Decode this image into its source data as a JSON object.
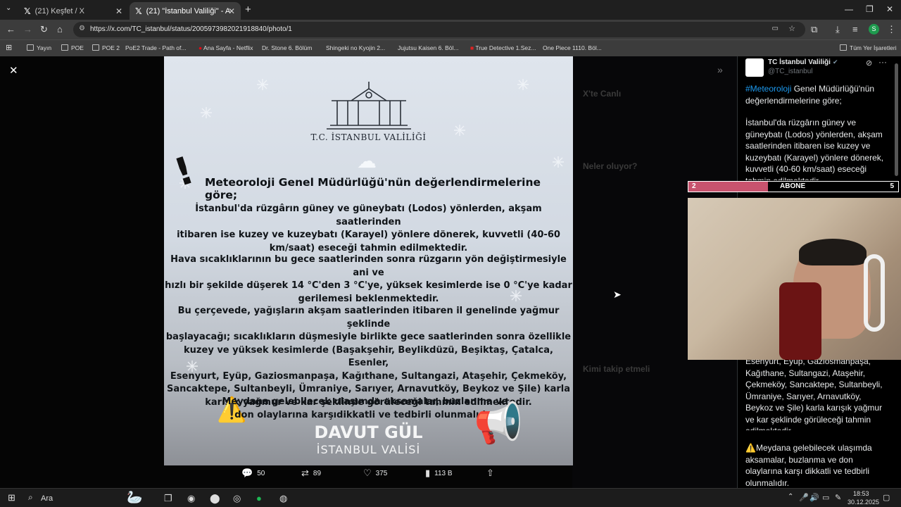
{
  "browser": {
    "tabs": [
      {
        "label": "(21) Keşfet / X",
        "close": "✕"
      },
      {
        "label": "(21) \"İstanbul Valiliği\" - Arama /",
        "close": "✕"
      }
    ],
    "new_tab": "+",
    "url": "https://x.com/TC_istanbul/status/2005973982021918840/photo/1",
    "profile_initial": "S",
    "bookmarks": [
      "Yayın",
      "POE",
      "POE 2",
      "PoE2 Trade - Path of...",
      "Ana Sayfa - Netflix",
      "Dr. Stone 6. Bölüm",
      "Shingeki no Kyojin 2...",
      "Jujutsu Kaisen 6. Böl...",
      "True Detective 1.Sez...",
      "One Piece 1110. Böl..."
    ],
    "all_bookmarks": "Tüm Yer İşaretleri"
  },
  "photo": {
    "institution": "T.C. İSTANBUL VALİLİĞİ",
    "heading": "Meteoroloji Genel Müdürlüğü'nün değerlendirmelerine göre;",
    "p1": [
      "İstanbul'da rüzgârın güney ve güneybatı (Lodos) yönlerden, akşam saatlerinden",
      "itibaren ise kuzey ve kuzeybatı (Karayel) yönlere dönerek, kuvvetli (40-60",
      "km/saat) eseceği  tahmin edilmektedir."
    ],
    "p2": [
      "Hava sıcaklıklarının bu gece saatlerinden sonra rüzgarın yön değiştirmesiyle ani ve",
      "hızlı bir şekilde düşerek 14 °C'den 3 °C'ye, yüksek kesimlerde ise 0 °C'ye kadar",
      "gerilemesi beklenmektedir."
    ],
    "p3": [
      "Bu çerçevede, yağışların akşam saatlerinden itibaren il genelinde yağmur şeklinde",
      "başlayacağı; sıcaklıkların düşmesiyle birlikte gece saatlerinden sonra özellikle",
      "kuzey ve yüksek kesimlerde (Başakşehir, Beylikdüzü, Beşiktaş, Çatalca, Esenler,",
      "Esenyurt, Eyüp, Gaziosmanpaşa, Kağıthane, Sultangazi, Ataşehir, Çekmeköy,",
      "Sancaktepe, Sultanbeyli, Ümraniye, Sarıyer, Arnavutköy, Beykoz ve Şile) karla",
      "karışık yağmur ve kar şeklinde görüleceği tahmin edilmektedir."
    ],
    "p4": [
      "Meydana gelebilecek ulaşımda aksamalar, buzlanma ve",
      "don olaylarına karşıdikkatli ve tedbirli olunmalıdır."
    ],
    "signature_name": "DAVUT GÜL",
    "signature_title": "İSTANBUL VALİSİ"
  },
  "actions": {
    "replies": "50",
    "reposts": "89",
    "likes": "375",
    "views": "113 B"
  },
  "tweet": {
    "author": "TC İstanbul Valiliği",
    "handle": "@TC_istanbul",
    "hashtag": "#Meteoroloji",
    "line1_rest": " Genel Müdürlüğü'nün değerlendirmelerine göre;",
    "para2": "İstanbul'da rüzgârın güney ve güneybatı (Lodos) yönlerden, akşam saatlerinden itibaren ise kuzey ve kuzeybatı (Karayel) yönlere dönerek, kuvvetli (40-60 km/saat) eseceği tahmin edilmektedir.",
    "para3": "Esenyurt, Eyüp, Gaziosmanpaşa, Kağıthane, Sultangazi, Ataşehir, Çekmeköy, Sancaktepe, Sultanbeyli, Ümraniye, Sarıyer, Arnavutköy, Beykoz ve Şile) karla karışık yağmur ve kar şeklinde görüleceği tahmin edilmektedir.",
    "para4": "⚠️Meydana gelebilecek ulaşımda aksamalar, buzlanma ve don olaylarına karşı dikkatli ve tedbirli olunmalıdır."
  },
  "background_sidebar": {
    "live": "X'te Canlı",
    "happening": "Neler oluyor?",
    "who_to_follow": "Kimi takip etmeli"
  },
  "overlay": {
    "left_num": "2",
    "label": "ABONE",
    "right_num": "5"
  },
  "taskbar": {
    "search": "Ara",
    "time": "18:53",
    "date": "30.12.2025"
  }
}
